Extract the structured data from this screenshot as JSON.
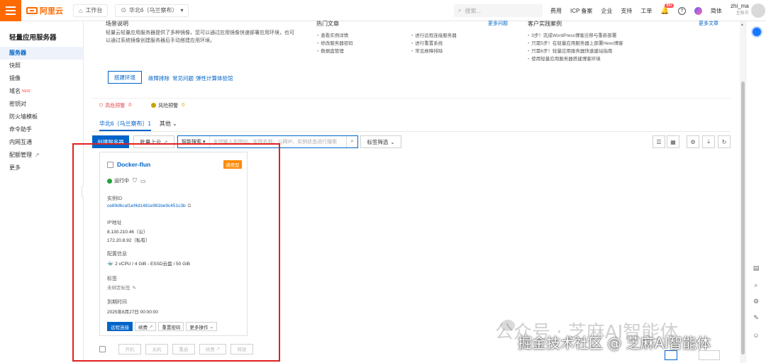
{
  "topbar": {
    "logo": "阿里云",
    "workbench": "工作台",
    "region": "华北6（乌兰察布）",
    "search_placeholder": "搜索...",
    "links": [
      "费用",
      "ICP 备案",
      "企业",
      "支持",
      "工单"
    ],
    "bell_badge": "99+",
    "help_icon": "?",
    "lang": "简体",
    "user_name": "zhi_ma",
    "user_sub": "主账号"
  },
  "sidebar": {
    "title": "轻量应用服务器",
    "items": [
      {
        "label": "服务器",
        "active": true
      },
      {
        "label": "快照"
      },
      {
        "label": "镜像"
      },
      {
        "label": "域名",
        "tag": "NEW"
      },
      {
        "label": "密钥对"
      },
      {
        "label": "防火墙模板"
      },
      {
        "label": "命令助手"
      },
      {
        "label": "内网互通"
      },
      {
        "label": "配额管理"
      },
      {
        "label": "更多"
      }
    ]
  },
  "help": {
    "col1_title": "场景说明",
    "col1_desc": "轻量云轻量应用服务器提供了多种镜像，您可以通过应用镜像快速部署应用环境，也可以通过系统镜像创建服务器后手动搭建应用环境。",
    "col2_title": "热门文章",
    "col2_more": "更多问题",
    "col2_links_a": [
      "查看实例详情",
      "修改服务器密码",
      "数据盘管理"
    ],
    "col2_links_b": [
      "进行远程连接服务器",
      "进行重置系统",
      "常见故障排除"
    ],
    "col3_title": "客户实践案例",
    "col3_more": "更多文章",
    "col3_links": [
      "3步！完成WordPress博客迁移与重新部署",
      "只需5步！在轻量应用服务器上部署Hexo博客",
      "只需6步！轻量应用服务器快速建站指南",
      "使用轻量应用服务器搭建博客环境"
    ],
    "button": "搭建环境",
    "text_links": [
      "故障排除",
      "常见问题",
      "弹性计算体验馆"
    ]
  },
  "alarms": {
    "high_label": "高危预警",
    "high_count": "0",
    "risk_label": "风险预警",
    "risk_count": "0"
  },
  "tabs": [
    {
      "label": "华北6（乌兰察布）1",
      "active": true
    },
    {
      "label": "其他"
    }
  ],
  "toolbar": {
    "create": "创建服务器",
    "batch": "批量上云",
    "filter_mode": "智能搜索",
    "filter_placeholder": "支持输入实例ID、实例名称、公网IP、实例状态进行搜索",
    "tag_filter": "标签筛选"
  },
  "card": {
    "name": "Docker-flun",
    "badge": "通用型",
    "status": "运行中",
    "instance_id_label": "实例ID",
    "instance_id": "ce89d6caf1ef4d1481e981be9c451c3b",
    "ip_label": "IP地址",
    "ip_public": "8.130.210.46（公）",
    "ip_private": "172.20.8.92（私有）",
    "config_label": "配置信息",
    "config": "2 vCPU / 4 GiB - ESSD云盘 / 50 GiB",
    "tag_label": "标签",
    "tag_value": "未绑定标签",
    "expire_label": "到期时间",
    "expire": "2025年8月27日 00:00:00",
    "actions": [
      "远程连接",
      "续费",
      "重置密码",
      "更多操作"
    ]
  },
  "bottom_actions": [
    "开机",
    "关机",
    "重启",
    "续费",
    "释放"
  ],
  "watermark": {
    "line1": "公众号 · 芝麻AI智能体",
    "line2": "掘金技术社区 @ 芝麻AI智能体"
  },
  "colors": {
    "brand": "#ff6a00",
    "primary": "#0064c8",
    "danger": "#e02020",
    "tag_orange": "#ff8a00",
    "running_green": "#22a33a"
  }
}
